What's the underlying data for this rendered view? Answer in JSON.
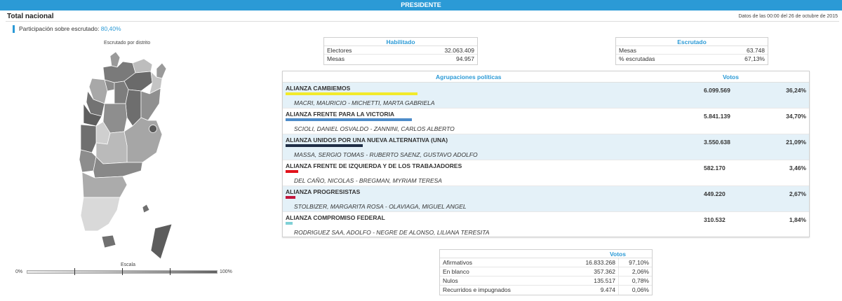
{
  "header": {
    "title": "PRESIDENTE",
    "section": "Total nacional",
    "timestamp": "Datos de las 00:00 del 26 de octubre de 2015"
  },
  "participation": {
    "label": "Participación sobre escrutado:",
    "value": "80,40%"
  },
  "map": {
    "title": "Escrutado por distrito",
    "scale_title": "Escala",
    "scale_min": "0%",
    "scale_max": "100%"
  },
  "habilitado": {
    "heading": "Habilitado",
    "rows": [
      {
        "label": "Electores",
        "value": "32.063.409"
      },
      {
        "label": "Mesas",
        "value": "94.957"
      }
    ]
  },
  "escrutado": {
    "heading": "Escrutado",
    "rows": [
      {
        "label": "Mesas",
        "value": "63.748"
      },
      {
        "label": "% escrutadas",
        "value": "67,13%"
      }
    ]
  },
  "results": {
    "col_party": "Agrupaciones políticas",
    "col_votes": "Votos",
    "parties": [
      {
        "name": "ALIANZA CAMBIEMOS",
        "candidates": "MACRI, MAURICIO - MICHETTI, MARTA GABRIELA",
        "votes": "6.099.569",
        "pct": "36,24%",
        "share": 0.3624,
        "color": "#f2ea2b"
      },
      {
        "name": "ALIANZA FRENTE PARA LA VICTORIA",
        "candidates": "SCIOLI, DANIEL OSVALDO - ZANNINI, CARLOS ALBERTO",
        "votes": "5.841.139",
        "pct": "34,70%",
        "share": 0.347,
        "color": "#4d8cc9"
      },
      {
        "name": "ALIANZA UNIDOS POR UNA NUEVA ALTERNATIVA (UNA)",
        "candidates": "MASSA, SERGIO TOMAS - RUBERTO SAENZ, GUSTAVO ADOLFO",
        "votes": "3.550.638",
        "pct": "21,09%",
        "share": 0.2109,
        "color": "#1f2e46"
      },
      {
        "name": "ALIANZA FRENTE DE IZQUIERDA Y DE LOS TRABAJADORES",
        "candidates": "DEL CAÑO, NICOLAS - BREGMAN, MYRIAM TERESA",
        "votes": "582.170",
        "pct": "3,46%",
        "share": 0.0346,
        "color": "#e2121b"
      },
      {
        "name": "ALIANZA PROGRESISTAS",
        "candidates": "STOLBIZER, MARGARITA ROSA - OLAVIAGA, MIGUEL ANGEL",
        "votes": "449.220",
        "pct": "2,67%",
        "share": 0.0267,
        "color": "#c2163c"
      },
      {
        "name": "ALIANZA COMPROMISO FEDERAL",
        "candidates": "RODRIGUEZ SAA, ADOLFO - NEGRE DE ALONSO, LILIANA TERESITA",
        "votes": "310.532",
        "pct": "1,84%",
        "share": 0.0184,
        "color": "#7fd0d6"
      }
    ]
  },
  "summary": {
    "heading": "Votos",
    "rows": [
      {
        "label": "Afirmativos",
        "votes": "16.833.268",
        "pct": "97,10%"
      },
      {
        "label": "En blanco",
        "votes": "357.362",
        "pct": "2,06%"
      },
      {
        "label": "Nulos",
        "votes": "135.517",
        "pct": "0,78%"
      },
      {
        "label": "Recurridos e impugnados",
        "votes": "9.474",
        "pct": "0,06%"
      }
    ]
  },
  "colors": {
    "accent": "#2b9ad6",
    "row_shade": "#e4f1f8"
  }
}
